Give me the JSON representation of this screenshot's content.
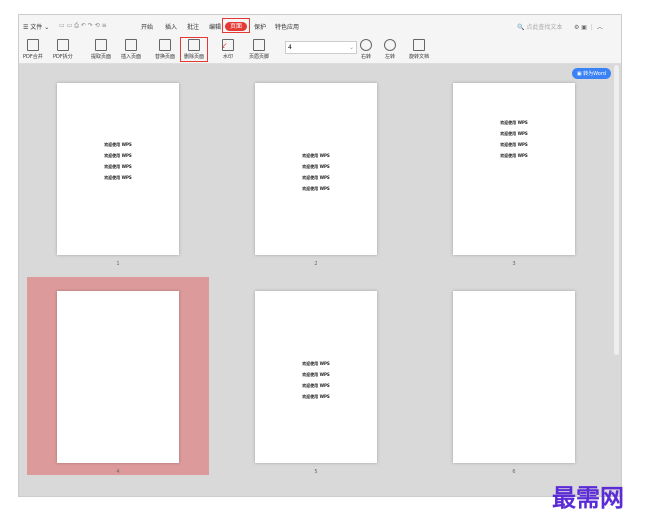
{
  "menu": {
    "file": "文件",
    "tabs": [
      "开始",
      "插入",
      "批注",
      "编辑",
      "页面",
      "保护",
      "特色应用"
    ],
    "active_tab": "页面",
    "search_placeholder": "点此查找文本"
  },
  "ribbon": {
    "buttons": [
      "PDF合并",
      "PDF拆分",
      "提取页面",
      "插入页面",
      "替换页面",
      "删除页面",
      "水印",
      "页眉页脚"
    ],
    "page_input": "4",
    "rotate": [
      "右转",
      "左转",
      "旋转文档"
    ]
  },
  "convert_button": "转为Word",
  "pages": [
    {
      "num": "1",
      "lines": [
        "欢迎使用 WPS",
        "欢迎使用 WPS",
        "欢迎使用 WPS",
        "欢迎使用 WPS"
      ]
    },
    {
      "num": "2",
      "lines": [
        "欢迎使用 WPS",
        "欢迎使用 WPS",
        "欢迎使用 WPS",
        "欢迎使用 WPS"
      ]
    },
    {
      "num": "3",
      "lines": [
        "欢迎使用 WPS",
        "欢迎使用 WPS",
        "欢迎使用 WPS",
        "欢迎使用 WPS"
      ]
    },
    {
      "num": "4",
      "lines": []
    },
    {
      "num": "5",
      "lines": [
        "欢迎使用 WPS",
        "欢迎使用 WPS",
        "欢迎使用 WPS",
        "欢迎使用 WPS"
      ]
    },
    {
      "num": "6",
      "lines": []
    }
  ],
  "selected_page": "4",
  "watermark": "最需网",
  "colors": {
    "accent": "#e53935",
    "selection": "#dd9a9a",
    "convert": "#3b82f6"
  }
}
